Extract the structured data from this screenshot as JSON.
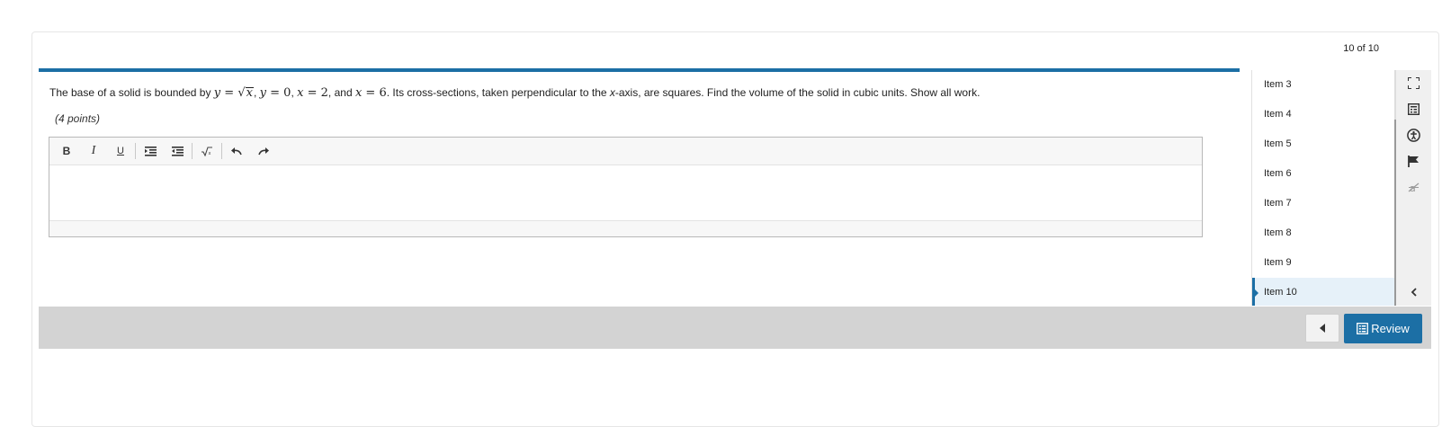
{
  "header": {
    "counter": "10 of 10"
  },
  "question": {
    "text_before": "The base of a solid is bounded by ",
    "math_bounds": {
      "y1": "y",
      "eq": " = ",
      "sqrt_arg": "x",
      "y2": "y",
      "zero": "0",
      "x1": "x",
      "two": "2",
      "x2": "x",
      "six": "6"
    },
    "comma": ", ",
    "and": ", and ",
    "text_after_1": ". Its cross-sections, taken perpendicular to the ",
    "x_axis_var": "x",
    "text_after_2": "-axis, are squares. Find the volume of the solid in cubic units. Show all work.",
    "points": "(4 points)"
  },
  "editor": {
    "toolbar": {
      "bold": "B",
      "italic": "I",
      "underline": "U",
      "math_icon": "sqrt-icon"
    }
  },
  "items": [
    {
      "label": "Item 3"
    },
    {
      "label": "Item 4"
    },
    {
      "label": "Item 5"
    },
    {
      "label": "Item 6"
    },
    {
      "label": "Item 7"
    },
    {
      "label": "Item 8"
    },
    {
      "label": "Item 9"
    },
    {
      "label": "Item 10",
      "active": true
    }
  ],
  "side_tools": [
    "fullscreen-icon",
    "calculator-icon",
    "accessibility-icon",
    "flag-icon",
    "strikethrough-icon"
  ],
  "footer": {
    "review_label": "Review"
  },
  "colors": {
    "accent": "#1c6fa5",
    "footer_bar": "#d3d3d3",
    "active_item_bg": "#e6f1f9"
  }
}
